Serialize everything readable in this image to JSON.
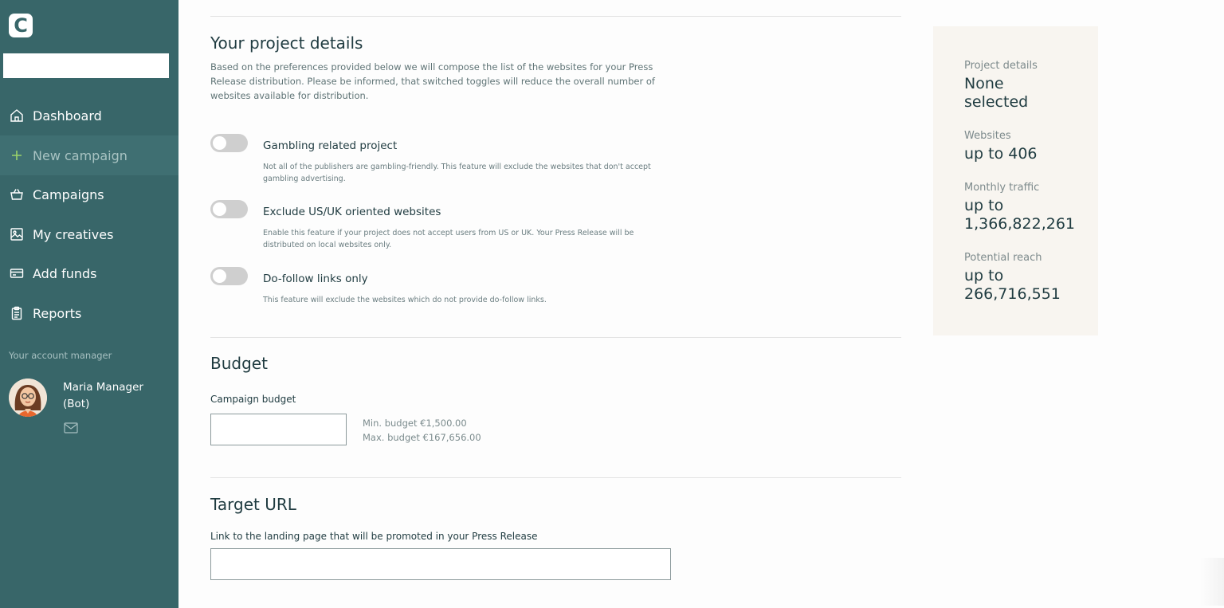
{
  "app": {
    "logo_letter": "C"
  },
  "sidebar": {
    "search": {
      "value": "",
      "placeholder": ""
    },
    "items": [
      {
        "label": "Dashboard",
        "icon": "home-icon"
      },
      {
        "label": "New campaign",
        "icon": "plus-icon"
      },
      {
        "label": "Campaigns",
        "icon": "basket-icon"
      },
      {
        "label": "My creatives",
        "icon": "image-icon"
      },
      {
        "label": "Add funds",
        "icon": "card-icon"
      },
      {
        "label": "Reports",
        "icon": "clipboard-icon"
      }
    ],
    "active_item": "New campaign",
    "account_manager": {
      "caption": "Your account manager",
      "name": "Maria Manager (Bot)",
      "icon": "mail-icon"
    }
  },
  "project_details": {
    "title": "Your project details",
    "intro": "Based on the preferences provided below we will compose the list of the websites for your Press Release distribution. Please be informed, that switched toggles will reduce the overall number of websites available for distribution.",
    "options": [
      {
        "title": "Gambling related project",
        "description": "Not all of the publishers are gambling-friendly. This feature will exclude the websites that don't accept gambling advertising.",
        "enabled": false
      },
      {
        "title": "Exclude US/UK oriented websites",
        "description": "Enable this feature if your project does not accept users from US or UK. Your Press Release will be distributed on local websites only.",
        "enabled": false
      },
      {
        "title": "Do-follow links only",
        "description": "This feature will exclude the websites which do not provide do-follow links.",
        "enabled": false
      }
    ]
  },
  "budget": {
    "title": "Budget",
    "label": "Campaign budget",
    "value": "",
    "min_text": "Min. budget €1,500.00",
    "max_text": "Max. budget €167,656.00"
  },
  "target_url": {
    "title": "Target URL",
    "label": "Link to the landing page that will be promoted in your Press Release",
    "value": ""
  },
  "summary": {
    "project_details_label": "Project details",
    "project_details_value": "None selected",
    "websites_label": "Websites",
    "websites_value": "up to 406",
    "traffic_label": "Monthly traffic",
    "traffic_value": "up to 1,366,822,261",
    "reach_label": "Potential reach",
    "reach_value": "up to 266,716,551"
  },
  "colors": {
    "sidebar_bg": "#386669",
    "active_item_bg": "#3f6f72",
    "accent_plus": "#9bd36a",
    "summary_bg": "#f8f5f0",
    "toggle_off": "#cfcfcf"
  }
}
